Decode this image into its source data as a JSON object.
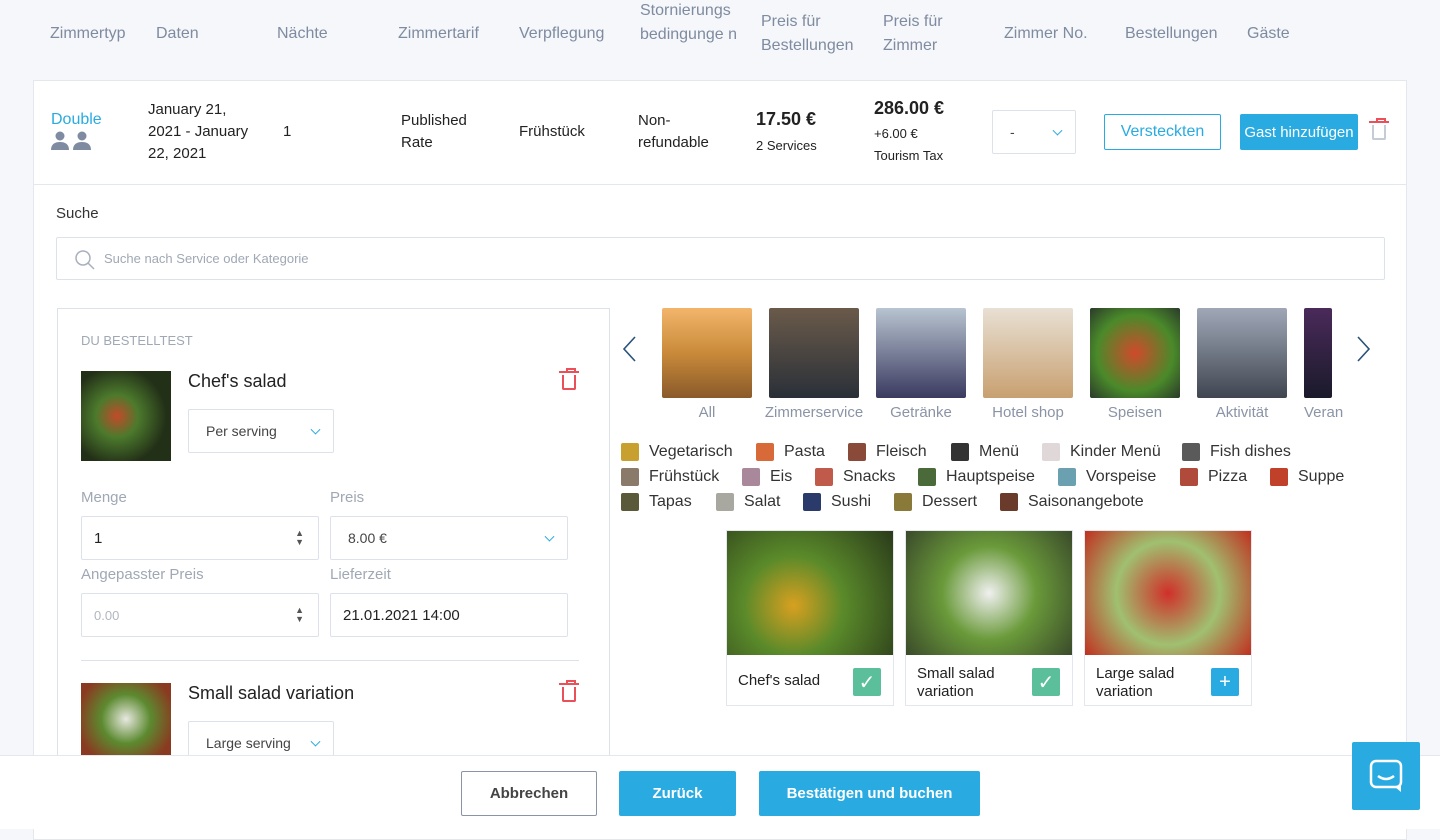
{
  "colors": {
    "accent": "#29abe2",
    "danger": "#e9505a",
    "check": "#5cbf9b",
    "header_text": "#7f8ba0"
  },
  "table_headers": [
    "Zimmertyp",
    "Daten",
    "Nächte",
    "Zimmertarif",
    "Verpflegung",
    "Stornierungs bedingunge n",
    "Preis für Bestellungen",
    "Preis für Zimmer",
    "Zimmer No.",
    "Bestellungen",
    "Gäste"
  ],
  "row": {
    "room_type": "Double",
    "dates": "January 21, 2021 - January 22, 2021",
    "nights": "1",
    "rate": "Published Rate",
    "board": "Frühstück",
    "cancel": "Non-refundable",
    "orders_price": "17.50 €",
    "orders_count": "2 Services",
    "room_price": "286.00 €",
    "tax": "+6.00 €",
    "tax_label": "Tourism Tax",
    "room_no": "-",
    "hide_label": "Versteckten",
    "add_guest_label": "Gast hinzufügen"
  },
  "search": {
    "label": "Suche",
    "placeholder": "Suche nach Service oder Kategorie"
  },
  "order": {
    "title": "DU BESTELLTEST",
    "items": [
      {
        "name": "Chef's salad",
        "variant": "Per serving",
        "qty_label": "Menge",
        "qty": "1",
        "price_label": "Preis",
        "price": "8.00 €",
        "custom_label": "Angepasster Preis",
        "custom_placeholder": "0.00",
        "delivery_label": "Lieferzeit",
        "delivery": "21.01.2021 14:00"
      },
      {
        "name": "Small salad variation",
        "variant": "Large serving"
      }
    ]
  },
  "categories": [
    {
      "label": "All",
      "icon": "landscape"
    },
    {
      "label": "Zimmerservice",
      "icon": "room"
    },
    {
      "label": "Getränke",
      "icon": "drinks"
    },
    {
      "label": "Hotel shop",
      "icon": "gift"
    },
    {
      "label": "Speisen",
      "icon": "food"
    },
    {
      "label": "Aktivität",
      "icon": "activity"
    },
    {
      "label": "Veran",
      "icon": "event"
    }
  ],
  "subcategories": [
    [
      "Vegetarisch",
      "Pasta",
      "Fleisch",
      "Menü",
      "Kinder Menü",
      "Fish dishes"
    ],
    [
      "Frühstück",
      "Eis",
      "Snacks",
      "Hauptspeise",
      "Vorspeise",
      "Pizza",
      "Suppe"
    ],
    [
      "Tapas",
      "Salat",
      "Sushi",
      "Dessert",
      "Saisonangebote"
    ]
  ],
  "products": [
    {
      "name": "Chef's salad",
      "state": "selected"
    },
    {
      "name": "Small salad variation",
      "state": "selected"
    },
    {
      "name": "Large salad variation",
      "state": "add"
    }
  ],
  "footer": {
    "cancel": "Abbrechen",
    "back": "Zurück",
    "confirm": "Bestätigen und buchen"
  }
}
